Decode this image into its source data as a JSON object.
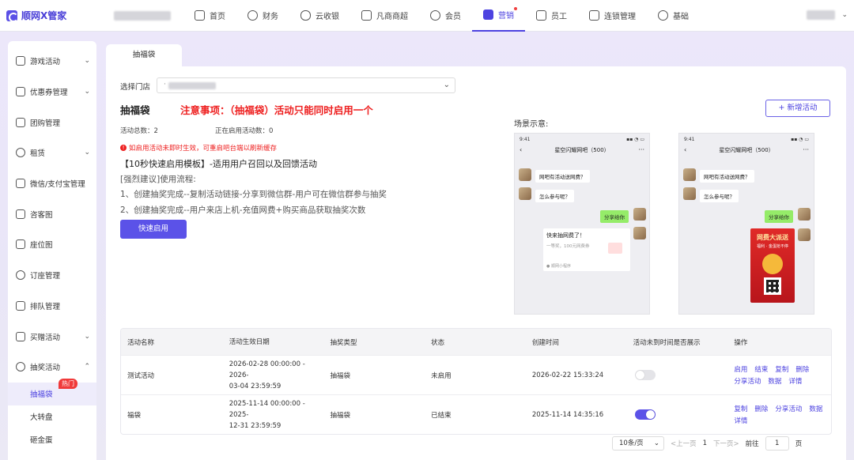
{
  "app": {
    "logo_text": "顺网X管家"
  },
  "nav": [
    {
      "label": "首页",
      "icon": "home-icon"
    },
    {
      "label": "财务",
      "icon": "finance-icon"
    },
    {
      "label": "云收银",
      "icon": "cloud-icon"
    },
    {
      "label": "凡商商超",
      "icon": "cart-icon"
    },
    {
      "label": "会员",
      "icon": "member-icon"
    },
    {
      "label": "营销",
      "icon": "gamepad-icon",
      "active": true
    },
    {
      "label": "员工",
      "icon": "staff-icon"
    },
    {
      "label": "连锁管理",
      "icon": "chain-icon"
    },
    {
      "label": "基础",
      "icon": "settings-icon"
    }
  ],
  "sidebar": {
    "items": [
      {
        "label": "游戏活动",
        "chevron": "⌄"
      },
      {
        "label": "优惠券管理",
        "chevron": "⌄"
      },
      {
        "label": "团购管理"
      },
      {
        "label": "租赁",
        "chevron": "⌄"
      },
      {
        "label": "微信/支付宝管理"
      },
      {
        "label": "咨客图"
      },
      {
        "label": "座位图"
      },
      {
        "label": "订座管理"
      },
      {
        "label": "排队管理"
      },
      {
        "label": "买赠活动",
        "chevron": "⌄"
      },
      {
        "label": "抽奖活动",
        "chevron": "⌃"
      }
    ],
    "subitems": [
      {
        "label": "抽福袋",
        "active": true,
        "badge": "热门"
      },
      {
        "label": "大转盘"
      },
      {
        "label": "砸金蛋"
      }
    ]
  },
  "tab": {
    "label": "抽福袋"
  },
  "main": {
    "store_label": "选择门店",
    "store_value": "·",
    "title": "抽福袋",
    "notice": "注意事项：（抽福袋）活动只能同时启用一个",
    "total_label": "活动总数：2",
    "active_label": "正在启用活动数：0",
    "warning": "如启用活动未即时生效，可重启吧台端以刷新缓存",
    "template_title": "【10秒快速启用模板】-适用用户召回以及回馈活动",
    "advice": "[强烈建议]使用流程:",
    "step1": "1、创建抽奖完成--复制活动链接-分享到微信群-用户可在微信群参与抽奖",
    "step2": "2、创建抽奖完成--用户来店上机-充值网费+购买商品获取抽奖次数",
    "quick_button": "快速启用",
    "new_button": "+ 新增活动",
    "scene_label": "场景示意:"
  },
  "phones": [
    {
      "time": "9:41",
      "status_icons": "▪▪ ◔ ▭",
      "title": "星空闪耀网吧（500）",
      "msg1": "网吧有活动送网费？",
      "msg2": "怎么参与呢？",
      "reply": "分享给你",
      "card_title": "快来抽网费了！",
      "card_sub": "一等奖，100元网费券",
      "card_footer": "● 顺网小程序"
    },
    {
      "time": "9:41",
      "status_icons": "▪▪ ◔ ▭",
      "title": "星空闪耀网吧（500）",
      "msg1": "网吧有活动送网费？",
      "msg2": "怎么参与呢？",
      "reply": "分享给你",
      "poster_title": "网费大派送",
      "poster_sub": "福利 · 金蛋抢不停"
    }
  ],
  "table": {
    "headers": [
      "活动名称",
      "活动生效日期",
      "抽奖类型",
      "状态",
      "创建时间",
      "活动未到时间是否展示",
      "操作"
    ],
    "rows": [
      {
        "name": "测试活动",
        "date_line1": "2026-02-28 00:00:00 - 2026-",
        "date_line2": "03-04 23:59:59",
        "type": "抽福袋",
        "status": "未启用",
        "created": "2026-02-22 15:33:24",
        "toggle_on": false,
        "ops": [
          "启用",
          "结束",
          "复制",
          "删除",
          "分享活动",
          "数据",
          "详情"
        ]
      },
      {
        "name": "福袋",
        "date_line1": "2025-11-14 00:00:00 - 2025-",
        "date_line2": "12-31 23:59:59",
        "type": "抽福袋",
        "status": "已结束",
        "created": "2025-11-14 14:35:16",
        "toggle_on": true,
        "ops": [
          "复制",
          "删除",
          "分享活动",
          "数据",
          "详情"
        ]
      }
    ]
  },
  "pager": {
    "page_size": "10条/页",
    "prev": "<上一页",
    "current": "1",
    "next": "下一页>",
    "goto_label": "前往",
    "goto_value": "1",
    "page_suffix": "页"
  }
}
